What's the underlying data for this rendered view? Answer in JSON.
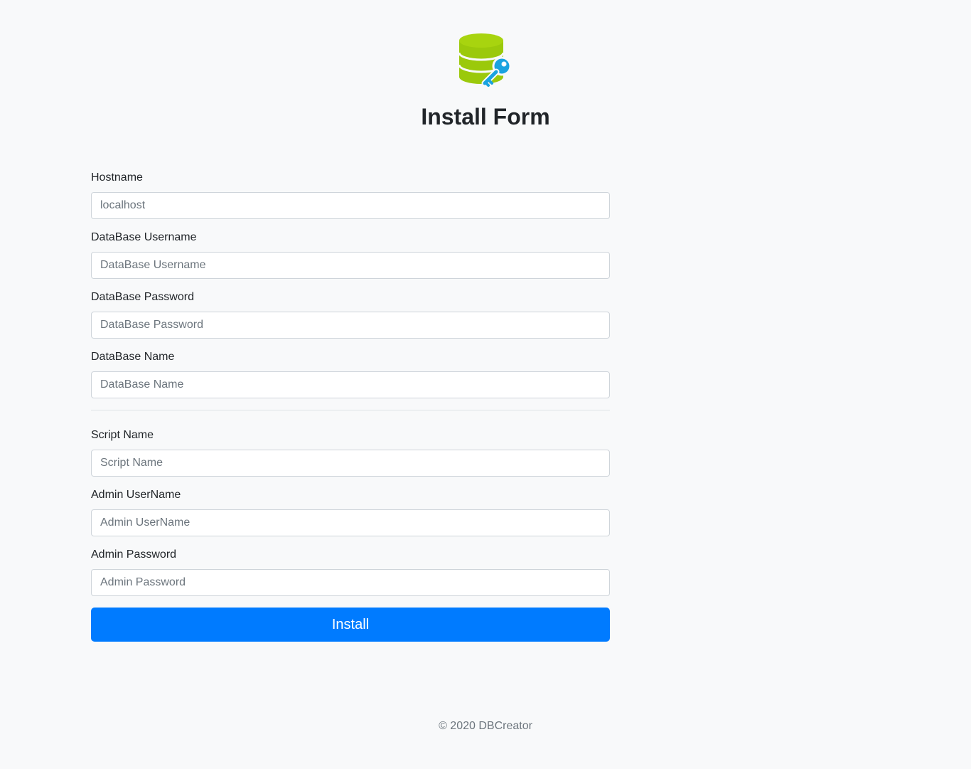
{
  "header": {
    "logo_icon": "database-key-icon",
    "title": "Install Form"
  },
  "form": {
    "hostname": {
      "label": "Hostname",
      "placeholder": "localhost"
    },
    "db_username": {
      "label": "DataBase Username",
      "placeholder": "DataBase Username"
    },
    "db_password": {
      "label": "DataBase Password",
      "placeholder": "DataBase Password"
    },
    "db_name": {
      "label": "DataBase Name",
      "placeholder": "DataBase Name"
    },
    "script_name": {
      "label": "Script Name",
      "placeholder": "Script Name"
    },
    "admin_username": {
      "label": "Admin UserName",
      "placeholder": "Admin UserName"
    },
    "admin_password": {
      "label": "Admin Password",
      "placeholder": "Admin Password"
    },
    "install_label": "Install"
  },
  "footer": {
    "text": "© 2020 DBCreator"
  },
  "colors": {
    "background": "#f8f9fa",
    "primary": "#007bff",
    "database_green": "#9bc90b",
    "key_blue": "#1aa3e0"
  }
}
